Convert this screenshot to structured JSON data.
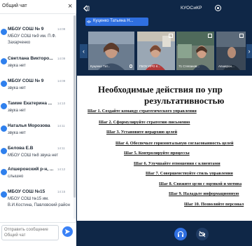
{
  "chat": {
    "title": "Общий чат",
    "close_glyph": "×",
    "messages": [
      {
        "name": "МБОУ СОШ № 9",
        "time": "14:09",
        "text": "МБОУ СОШ №9 им. П.Ф. Захарченко"
      },
      {
        "name": "Светлана Викторо...",
        "time": "14:09",
        "text": "звука нет"
      },
      {
        "name": "МБОУ СОШ № 9",
        "time": "14:09",
        "text": "звука нет"
      },
      {
        "name": "Тамме Екатерина ...",
        "time": "14:10",
        "text": "звука нет"
      },
      {
        "name": "Наталья Морозова",
        "time": "14:11",
        "text": "звука нет"
      },
      {
        "name": "Белова Е.В",
        "time": "14:11",
        "text": "МБОУ СОШ №8 звука нет"
      },
      {
        "name": "Апшеронский р-н, ...",
        "time": "14:12",
        "text": "слышно"
      },
      {
        "name": "МБОУ СОШ №15",
        "time": "14:15",
        "text": "МБОУ СОШ №15 им. В.И.Костина, Павловский район"
      }
    ],
    "input_placeholder": "Отправить сообщение Общий чат",
    "avatar_color": "#2f80ed",
    "send_color": "#3b82f6"
  },
  "conference": {
    "room_title": "КУОСиКР",
    "active_speaker": "Куценко Татьяна Н...",
    "tiles": [
      {
        "label": "Куценко Тат..."
      },
      {
        "label": "ГБОУ ИРО К..."
      },
      {
        "label": "71 Степанов..."
      },
      {
        "label": "Апшерон..."
      }
    ],
    "background_color": "#0f2747",
    "accent_color": "#2f6fe0",
    "nav_left": "‹",
    "nav_right": "›"
  },
  "slide": {
    "title_line1": "Необходимые действия по упр",
    "title_line2": "результативностью",
    "steps": [
      "Шаг 1. Создайте команду стратегического управления",
      "Шаг 2. Сформулируйте стратегию письменно",
      "Шаг 3. Установите иерархию целей",
      "Шаг 4. Обеспечьте горизонтальную согласованность целей",
      "Шаг 5. Контролируйте процессы",
      "Шаг 6. Улучшайте отношения с клиентами",
      "Шаг 7. Совершенствуйте стиль управления",
      "Шаг 8. Свяжите цели с оценкой и мотива",
      "Шаг 9. Наладьте информационную",
      "Шаг 10. Позволяйте персонал"
    ]
  },
  "controls": {
    "icons": [
      "headphones-icon",
      "camera-off-icon"
    ]
  }
}
